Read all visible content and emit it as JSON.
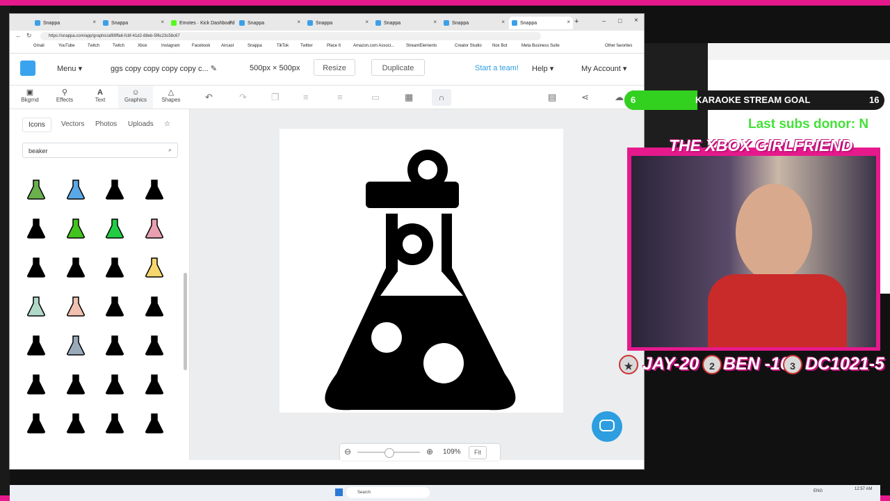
{
  "browser": {
    "tabs": [
      {
        "label": "Snappa",
        "active": false
      },
      {
        "label": "Snappa",
        "active": false
      },
      {
        "label": "Emotes · Kick Dashboard",
        "active": false
      },
      {
        "label": "Snappa",
        "active": false
      },
      {
        "label": "Snappa",
        "active": false
      },
      {
        "label": "Snappa",
        "active": false
      },
      {
        "label": "Snappa",
        "active": false
      },
      {
        "label": "Snappa",
        "active": true
      }
    ],
    "url": "https://snappa.com/app/graphic/af89ffa6-fcbf-41d2-88eb-5f6c23c58c67",
    "bookmarks": [
      "Gmail",
      "YouTube",
      "Twitch",
      "Twitch",
      "Xbox",
      "Instagram",
      "Facebook",
      "Aircast",
      "Snappa",
      "TikTok",
      "Twitter",
      "Place It",
      "Amazon.com Associ...",
      "StreamElements",
      "Creator Studio",
      "Nox Bot",
      "Meta Business Suite",
      "Other favorites"
    ]
  },
  "app": {
    "menu_label": "Menu",
    "doc_title": "ggs copy copy copy copy c...",
    "size_label": "500px × 500px",
    "resize_label": "Resize",
    "duplicate_label": "Duplicate",
    "team_label": "Start a team!",
    "help_label": "Help",
    "account_label": "My Account",
    "accent": "#2d9ee0"
  },
  "left_tabs": [
    {
      "label": "Bkgrnd",
      "icon": "image-icon"
    },
    {
      "label": "Effects",
      "icon": "wand-icon"
    },
    {
      "label": "Text",
      "icon": "text-icon"
    },
    {
      "label": "Graphics",
      "icon": "smiley-icon"
    },
    {
      "label": "Shapes",
      "icon": "triangle-icon"
    }
  ],
  "graphics_subtabs": [
    "Icons",
    "Vectors",
    "Photos",
    "Uploads"
  ],
  "search": {
    "value": "beaker"
  },
  "zoom": {
    "value": "109%",
    "fit_label": "Fit"
  },
  "taskbar": {
    "search_label": "Search",
    "lang": "ENG",
    "time": "12:57 AM"
  },
  "overlay": {
    "goal_left": "6",
    "goal_title": "KARAOKE STREAM GOAL",
    "goal_right": "16",
    "goal_progress": 0.375,
    "donor_text": "Last subs donor: N",
    "cam_title": "THE XBOX GIRLFRIEND",
    "leaders": [
      {
        "rank": "2",
        "text": "BEN -10"
      },
      {
        "rank": "3",
        "text": "DC1021-5"
      }
    ],
    "leader_first": "JAY-20"
  }
}
